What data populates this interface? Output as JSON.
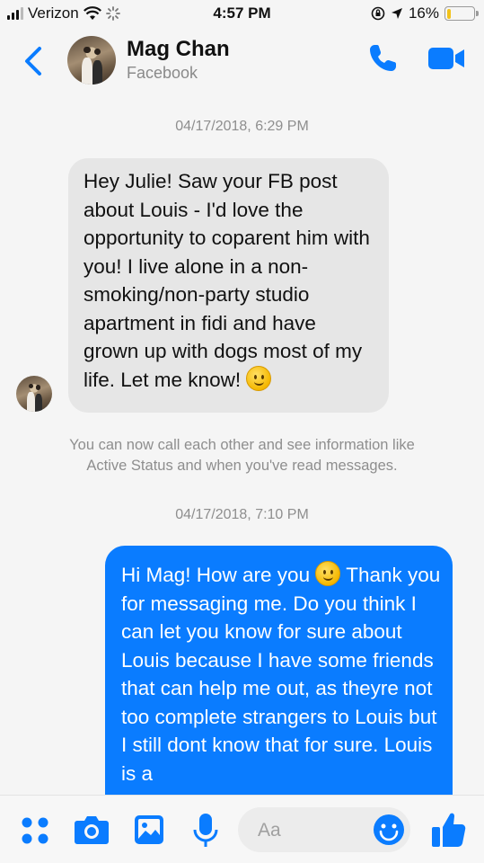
{
  "status_bar": {
    "carrier": "Verizon",
    "time": "4:57 PM",
    "battery": "16%",
    "battery_level": 0.16,
    "icons": [
      "signal-icon",
      "wifi-icon",
      "loading-spinner-icon",
      "orientation-lock-icon",
      "location-arrow-icon",
      "battery-icon"
    ]
  },
  "header": {
    "contact_name": "Mag Chan",
    "subtitle": "Facebook",
    "icons": [
      "back-chevron-icon",
      "phone-icon",
      "video-camera-icon"
    ]
  },
  "thread": {
    "timestamp_1": "04/17/2018, 6:29 PM",
    "incoming_message": "Hey Julie! Saw your FB post about Louis - I'd love the opportunity to coparent him with you! I live alone in a non-smoking/non-party studio apartment in fidi and have grown up with dogs most of my life. Let me know!",
    "system_note_line1": "You can now call each other and see information like",
    "system_note_line2": "Active Status and when you've read messages.",
    "timestamp_2": "04/17/2018, 7:10 PM",
    "outgoing_message_part1": "Hi Mag! How are you",
    "outgoing_message_part2": "Thank you for messaging me. Do you think I can let you know for sure about Louis because I have some friends that can help me out, as theyre not too complete strangers to Louis but I still dont know that for sure.  Louis is a"
  },
  "composer": {
    "placeholder": "Aa",
    "icons": [
      "more-dots-icon",
      "camera-icon",
      "gallery-icon",
      "microphone-icon",
      "emoji-icon",
      "thumbs-up-icon"
    ]
  },
  "colors": {
    "accent_blue": "#0a7cff",
    "incoming_bubble": "#e6e6e6",
    "background": "#f5f5f5"
  }
}
